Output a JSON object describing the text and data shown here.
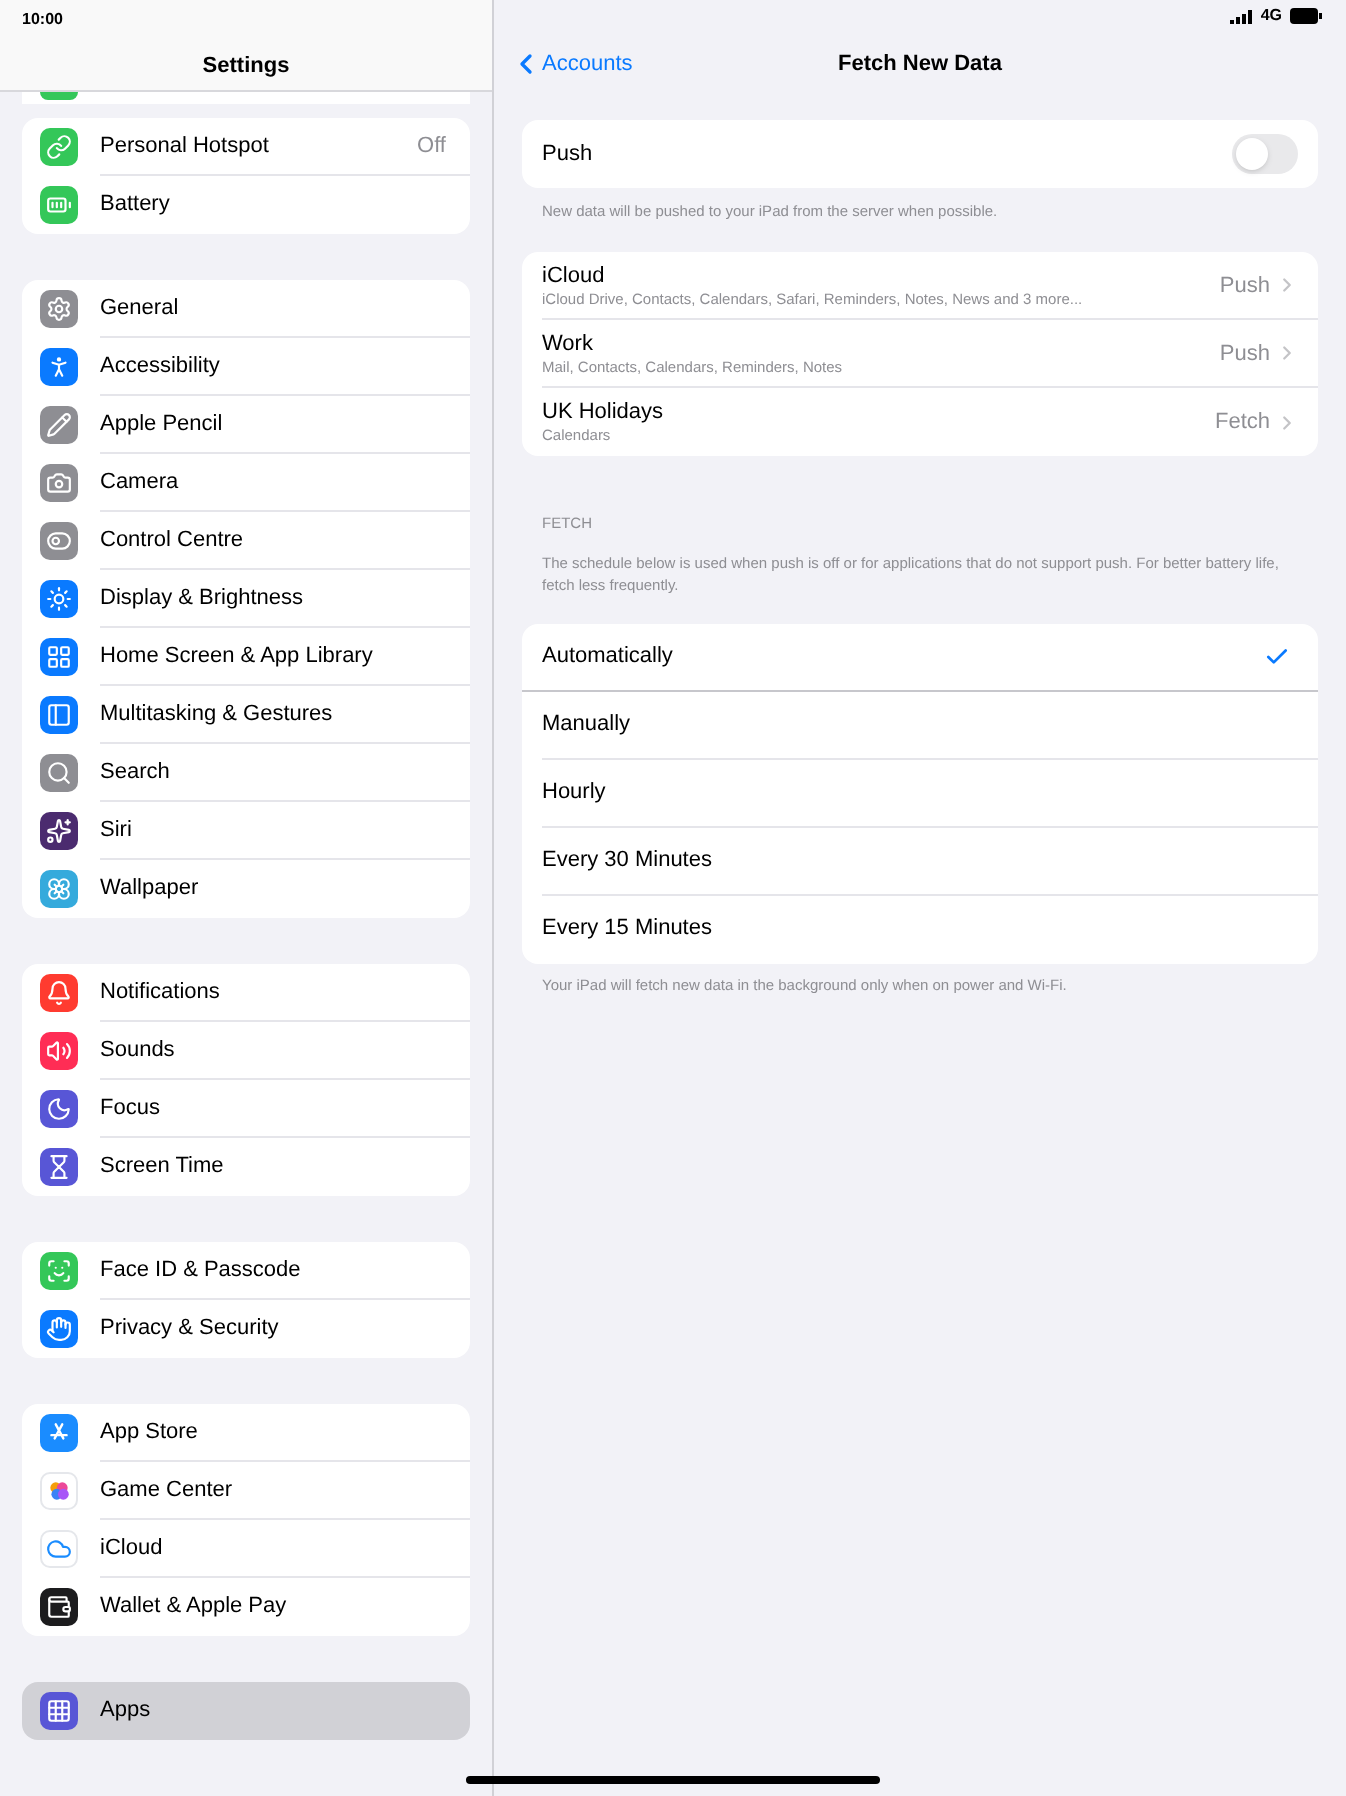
{
  "status_bar": {
    "time": "10:00",
    "network": "4G"
  },
  "sidebar": {
    "title": "Settings",
    "groups": [
      {
        "items": [
          {
            "label": "Personal Hotspot",
            "value": "Off",
            "selected": false
          },
          {
            "label": "Battery",
            "selected": false
          }
        ]
      },
      {
        "items": [
          {
            "label": "General",
            "selected": false
          },
          {
            "label": "Accessibility",
            "selected": false
          },
          {
            "label": "Apple Pencil",
            "selected": false
          },
          {
            "label": "Camera",
            "selected": false
          },
          {
            "label": "Control Centre",
            "selected": false
          },
          {
            "label": "Display & Brightness",
            "selected": false
          },
          {
            "label": "Home Screen & App Library",
            "selected": false
          },
          {
            "label": "Multitasking & Gestures",
            "selected": false
          },
          {
            "label": "Search",
            "selected": false
          },
          {
            "label": "Siri",
            "selected": false
          },
          {
            "label": "Wallpaper",
            "selected": false
          }
        ]
      },
      {
        "items": [
          {
            "label": "Notifications",
            "selected": false
          },
          {
            "label": "Sounds",
            "selected": false
          },
          {
            "label": "Focus",
            "selected": false
          },
          {
            "label": "Screen Time",
            "selected": false
          }
        ]
      },
      {
        "items": [
          {
            "label": "Face ID & Passcode",
            "selected": false
          },
          {
            "label": "Privacy & Security",
            "selected": false
          }
        ]
      },
      {
        "items": [
          {
            "label": "App Store",
            "selected": false
          },
          {
            "label": "Game Center",
            "selected": false
          },
          {
            "label": "iCloud",
            "selected": false
          },
          {
            "label": "Wallet & Apple Pay",
            "selected": false
          }
        ]
      },
      {
        "items": [
          {
            "label": "Apps",
            "selected": true
          }
        ]
      }
    ]
  },
  "detail": {
    "back": "Accounts",
    "title": "Fetch New Data",
    "push": {
      "label": "Push",
      "on": false,
      "footnote": "New data will be pushed to your iPad from the server when possible."
    },
    "accounts": [
      {
        "name": "iCloud",
        "subtitle": "iCloud Drive, Contacts, Calendars, Safari, Reminders, Notes, News and 3 more...",
        "value": "Push"
      },
      {
        "name": "Work",
        "subtitle": "Mail, Contacts, Calendars, Reminders, Notes",
        "value": "Push"
      },
      {
        "name": "UK Holidays",
        "subtitle": "Calendars",
        "value": "Fetch"
      }
    ],
    "fetch": {
      "header": "FETCH",
      "description": "The schedule below is used when push is off or for applications that do not support push. For better battery life, fetch less frequently.",
      "options": [
        {
          "label": "Automatically",
          "selected": true
        },
        {
          "label": "Manually",
          "selected": false
        },
        {
          "label": "Hourly",
          "selected": false
        },
        {
          "label": "Every 30 Minutes",
          "selected": false
        },
        {
          "label": "Every 15 Minutes",
          "selected": false
        }
      ],
      "footnote": "Your iPad will fetch new data in the background only when on power and Wi-Fi."
    }
  }
}
